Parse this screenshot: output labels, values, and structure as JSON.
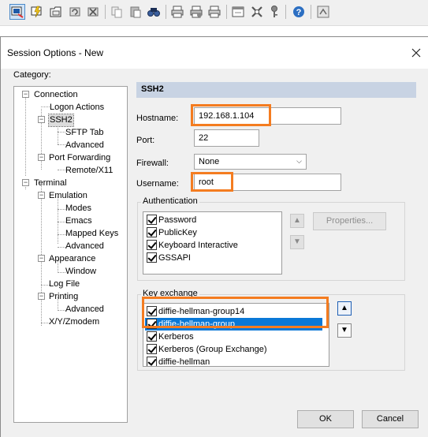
{
  "toolbar": {
    "icons": [
      "connect-icon",
      "quick-connect-icon",
      "connect-tab-icon",
      "reconnect-icon",
      "disconnect-icon",
      "copy-icon",
      "paste-icon",
      "find-icon",
      "print-icon",
      "print-setup-icon",
      "print-selection-icon",
      "session-options-icon",
      "global-options-icon",
      "key-icon",
      "help-icon",
      "sftp-icon"
    ]
  },
  "dialog": {
    "title": "Session Options - New",
    "category_label": "Category:",
    "tree": [
      {
        "label": "Connection"
      },
      {
        "label": "Logon Actions"
      },
      {
        "label": "SSH2"
      },
      {
        "label": "SFTP Tab"
      },
      {
        "label": "Advanced"
      },
      {
        "label": "Port Forwarding"
      },
      {
        "label": "Remote/X11"
      },
      {
        "label": "Terminal"
      },
      {
        "label": "Emulation"
      },
      {
        "label": "Modes"
      },
      {
        "label": "Emacs"
      },
      {
        "label": "Mapped Keys"
      },
      {
        "label": "Advanced"
      },
      {
        "label": "Appearance"
      },
      {
        "label": "Window"
      },
      {
        "label": "Log File"
      },
      {
        "label": "Printing"
      },
      {
        "label": "Advanced"
      },
      {
        "label": "X/Y/Zmodem"
      }
    ],
    "selected_category": "SSH2",
    "section_header": "SSH2",
    "hostname": {
      "label": "Hostname:",
      "value": "192.168.1.104"
    },
    "port": {
      "label": "Port:",
      "value": "22"
    },
    "firewall": {
      "label": "Firewall:",
      "value": "None"
    },
    "username": {
      "label": "Username:",
      "value": "root"
    },
    "authentication": {
      "title": "Authentication",
      "items": [
        {
          "label": "Password",
          "checked": true
        },
        {
          "label": "PublicKey",
          "checked": true
        },
        {
          "label": "Keyboard Interactive",
          "checked": true
        },
        {
          "label": "GSSAPI",
          "checked": true
        }
      ],
      "properties_button": "Properties..."
    },
    "key_exchange": {
      "title": "Key exchange",
      "items": [
        {
          "label": "diffie-hellman-group14",
          "checked": true
        },
        {
          "label": "diffie-hellman-group",
          "checked": true,
          "selected": true
        },
        {
          "label": "Kerberos",
          "checked": true
        },
        {
          "label": "Kerberos (Group Exchange)",
          "checked": true
        },
        {
          "label": "diffie-hellman",
          "checked": true
        }
      ]
    },
    "ok_button": "OK",
    "cancel_button": "Cancel",
    "highlight_color": "#f47c20",
    "selection_color": "#0a78d7"
  }
}
